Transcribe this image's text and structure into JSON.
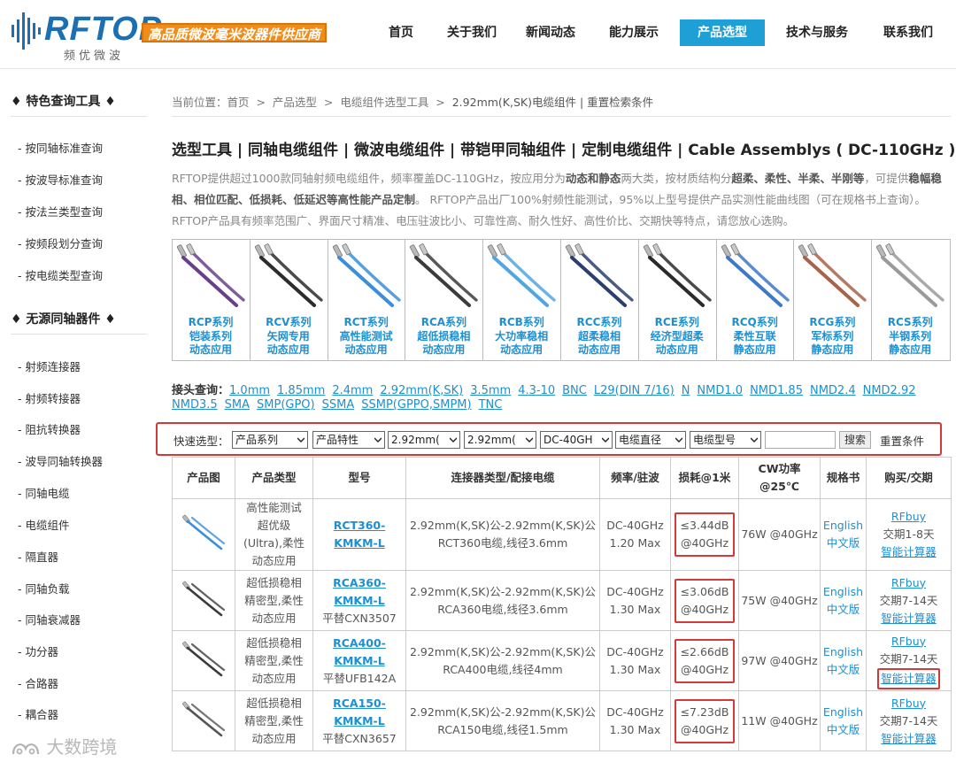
{
  "header": {
    "logo_text": "RFTOP",
    "logo_sub": "频优微波",
    "tagline": "高品质微波毫米波器件供应商",
    "nav": [
      "首页",
      "关于我们",
      "新闻动态",
      "能力展示",
      "产品选型",
      "技术与服务",
      "联系我们"
    ],
    "active_nav": "产品选型"
  },
  "sidebar": {
    "section1_title": "♦ 特色查询工具 ♦",
    "section1_items": [
      "按同轴标准查询",
      "按波导标准查询",
      "按法兰类型查询",
      "按频段划分查询",
      "按电缆类型查询"
    ],
    "section2_title": "♦ 无源同轴器件 ♦",
    "section2_items": [
      "射频连接器",
      "射频转接器",
      "阻抗转换器",
      "波导同轴转换器",
      "同轴电缆",
      "电缆组件",
      "隔直器",
      "同轴负载",
      "同轴衰减器",
      "功分器",
      "合路器",
      "耦合器"
    ]
  },
  "breadcrumb": {
    "prefix": "当前位置：",
    "items": [
      "首页",
      "产品选型",
      "电缆组件选型工具",
      "2.92mm(K,SK)电缆组件 | 重置检索条件"
    ],
    "sep": ">"
  },
  "main": {
    "title": "选型工具 | 同轴电缆组件 | 微波电缆组件 | 带铠甲同轴组件 | 定制电缆组件 | Cable Assemblys ( DC-110GHz )",
    "intro_parts": [
      {
        "t": "RFTOP提供超过1000款同轴射频电缆组件，频率覆盖DC-110GHz，按应用分为",
        "b": false
      },
      {
        "t": "动态和静态",
        "b": true
      },
      {
        "t": "两大类，按材质结构分",
        "b": false
      },
      {
        "t": "超柔、柔性、半柔、半刚等",
        "b": true
      },
      {
        "t": "，可提供",
        "b": false
      },
      {
        "t": "稳幅稳相、相位匹配、低损耗、低延迟等高性能产品定制",
        "b": true
      },
      {
        "t": "。 RFTOP产品出厂100%射频性能测试，95%以上型号提供产品实测性能曲线图（可在规格书上查询）。RFTOP产品具有频率范围广、界面尺寸精准、电压驻波比小、可靠性高、耐久性好、高性价比、交期快等特点，请您放心选购。",
        "b": false
      }
    ]
  },
  "products": [
    {
      "l1": "RCP系列",
      "l2": "铠装系列",
      "l3": "动态应用",
      "color": "#6a3f8a"
    },
    {
      "l1": "RCV系列",
      "l2": "矢网专用",
      "l3": "动态应用",
      "color": "#2c2c2c"
    },
    {
      "l1": "RCT系列",
      "l2": "高性能测试",
      "l3": "动态应用",
      "color": "#3a8fd8"
    },
    {
      "l1": "RCA系列",
      "l2": "超低损稳相",
      "l3": "动态应用",
      "color": "#3b3b3b"
    },
    {
      "l1": "RCB系列",
      "l2": "大功率稳相",
      "l3": "动态应用",
      "color": "#4fa6e0"
    },
    {
      "l1": "RCC系列",
      "l2": "超柔稳相",
      "l3": "动态应用",
      "color": "#2a3f6e"
    },
    {
      "l1": "RCE系列",
      "l2": "经济型超柔",
      "l3": "动态应用",
      "color": "#2a2a2a"
    },
    {
      "l1": "RCQ系列",
      "l2": "柔性互联",
      "l3": "静态应用",
      "color": "#3d78c9"
    },
    {
      "l1": "RCG系列",
      "l2": "军标系列",
      "l3": "静态应用",
      "color": "#a8624a"
    },
    {
      "l1": "RCS系列",
      "l2": "半钢系列",
      "l3": "静态应用",
      "color": "#9a9a9a"
    }
  ],
  "connectors": {
    "label": "接头查询：",
    "line1": [
      "1.0mm",
      "1.85mm",
      "2.4mm",
      "2.92mm(K,SK)",
      "3.5mm",
      "4.3-10",
      "BNC",
      "L29(DIN 7/16)",
      "N",
      "NMD1.0",
      "NMD1.85",
      "NMD2.4",
      "NMD2.92"
    ],
    "line2": [
      "NMD3.5",
      "SMA",
      "SMP(GPO)",
      "SSMA",
      "SSMP(GPPO,SMPM)",
      "TNC"
    ]
  },
  "quick": {
    "label": "快速选型：",
    "selects": [
      "产品系列",
      "产品特性",
      "2.92mm(",
      "2.92mm(",
      "DC-40GH",
      "电缆直径",
      "电缆型号"
    ],
    "search_label": "搜索",
    "reset_label": "重置条件"
  },
  "table": {
    "headers": [
      "产品图",
      "产品类型",
      "型号",
      "连接器类型/配接电缆",
      "频率/驻波",
      "损耗@1米",
      "CW功率@25℃",
      "规格书",
      "购买/交期"
    ],
    "rows": [
      {
        "type": [
          "高性能测试",
          "超优级",
          "(Ultra),柔性",
          "动态应用"
        ],
        "model": [
          "RCT360-",
          "KMKM-L"
        ],
        "sub": "",
        "conn": [
          "2.92mm(K,SK)公-2.92mm(K,SK)公",
          "RCT360电缆,线径3.6mm"
        ],
        "freq": [
          "DC-40GHz",
          "1.20 Max"
        ],
        "loss": [
          "≤3.44dB",
          "@40GHz"
        ],
        "cw": "76W @40GHz",
        "spec": [
          "English",
          "中文版"
        ],
        "buy": [
          "RFbuy",
          "交期1-8天",
          "智能计算器"
        ],
        "calc_hl": false,
        "color": "#3a8fd8"
      },
      {
        "type": [
          "超低损稳相",
          "精密型,柔性",
          "动态应用"
        ],
        "model": [
          "RCA360-",
          "KMKM-L"
        ],
        "sub": "平替CXN3507",
        "conn": [
          "2.92mm(K,SK)公-2.92mm(K,SK)公",
          "RCA360电缆,线径3.6mm"
        ],
        "freq": [
          "DC-40GHz",
          "1.30 Max"
        ],
        "loss": [
          "≤3.06dB",
          "@40GHz"
        ],
        "cw": "75W @40GHz",
        "spec": [
          "English",
          "中文版"
        ],
        "buy": [
          "RFbuy",
          "交期7-14天",
          "智能计算器"
        ],
        "calc_hl": false,
        "color": "#3b3b3b"
      },
      {
        "type": [
          "超低损稳相",
          "精密型,柔性",
          "动态应用"
        ],
        "model": [
          "RCA400-",
          "KMKM-L"
        ],
        "sub": "平替UFB142A",
        "conn": [
          "2.92mm(K,SK)公-2.92mm(K,SK)公",
          "RCA400电缆,线径4mm"
        ],
        "freq": [
          "DC-40GHz",
          "1.30 Max"
        ],
        "loss": [
          "≤2.66dB",
          "@40GHz"
        ],
        "cw": "97W @40GHz",
        "spec": [
          "English",
          "中文版"
        ],
        "buy": [
          "RFbuy",
          "交期7-14天",
          "智能计算器"
        ],
        "calc_hl": true,
        "color": "#3b3b3b"
      },
      {
        "type": [
          "超低损稳相",
          "精密型,柔性",
          "动态应用"
        ],
        "model": [
          "RCA150-",
          "KMKM-L"
        ],
        "sub": "平替CXN3657",
        "conn": [
          "2.92mm(K,SK)公-2.92mm(K,SK)公",
          "RCA150电缆,线径1.5mm"
        ],
        "freq": [
          "DC-40GHz",
          "1.30 Max"
        ],
        "loss": [
          "≤7.23dB",
          "@40GHz"
        ],
        "cw": "11W @40GHz",
        "spec": [
          "English",
          "中文版"
        ],
        "buy": [
          "RFbuy",
          "交期7-14天",
          "智能计算器"
        ],
        "calc_hl": false,
        "color": "#555555"
      }
    ]
  },
  "watermark": "大数跨境",
  "colors": {
    "accent": "#1e9fd6",
    "link": "#1e8fd0",
    "highlight": "#d23a3a",
    "tagline_bg": "#f08c1a"
  }
}
